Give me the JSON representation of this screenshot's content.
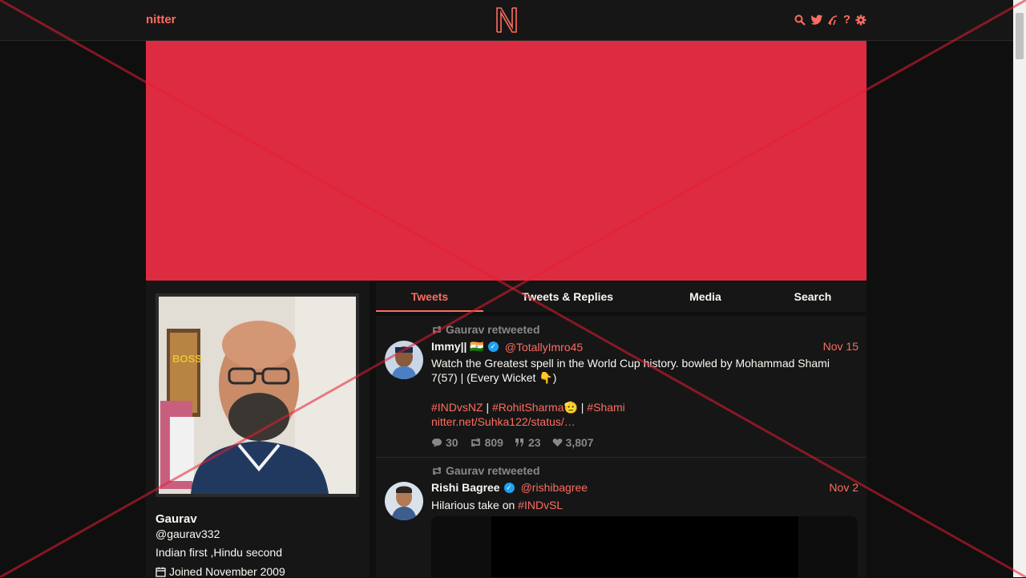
{
  "nav": {
    "brand": "nitter",
    "logo_letter": "N",
    "icons": [
      "search-icon",
      "twitter-icon",
      "rss-icon",
      "help-icon",
      "settings-icon"
    ],
    "help_glyph": "?"
  },
  "colors": {
    "accent": "#ff6c60",
    "banner": "#dd2c41",
    "background": "#0f0f0f",
    "panel": "#161616",
    "muted": "#888889",
    "verified": "#1da1f2"
  },
  "profile": {
    "name": "Gaurav",
    "handle": "@gaurav332",
    "bio": "Indian first ,Hindu second",
    "joined": "Joined November 2009"
  },
  "tabs": [
    {
      "label": "Tweets",
      "active": true
    },
    {
      "label": "Tweets & Replies",
      "active": false
    },
    {
      "label": "Media",
      "active": false
    },
    {
      "label": "Search",
      "active": false
    }
  ],
  "tweets": [
    {
      "retweet_header": "Gaurav retweeted",
      "fullname": "Immy|| 🇮🇳",
      "verified": true,
      "username": "@TotallyImro45",
      "date": "Nov 15",
      "text_line1": "Watch the Greatest spell in the World Cup history. bowled by Mohammad Shami",
      "text_line2": "7(57) | (Every Wicket 👇)",
      "hashtags": [
        "#INDvsNZ",
        "#RohitSharma🫡",
        "#Shami"
      ],
      "separator": "|",
      "link": "nitter.net/Suhka122/status/…",
      "stats": {
        "replies": "30",
        "retweets": "809",
        "quotes": "23",
        "likes": "3,807"
      }
    },
    {
      "retweet_header": "Gaurav retweeted",
      "fullname": "Rishi Bagree",
      "verified": true,
      "username": "@rishibagree",
      "date": "Nov 2",
      "text_prefix": "Hilarious take on ",
      "text_hashtag": "#INDvSL"
    }
  ]
}
